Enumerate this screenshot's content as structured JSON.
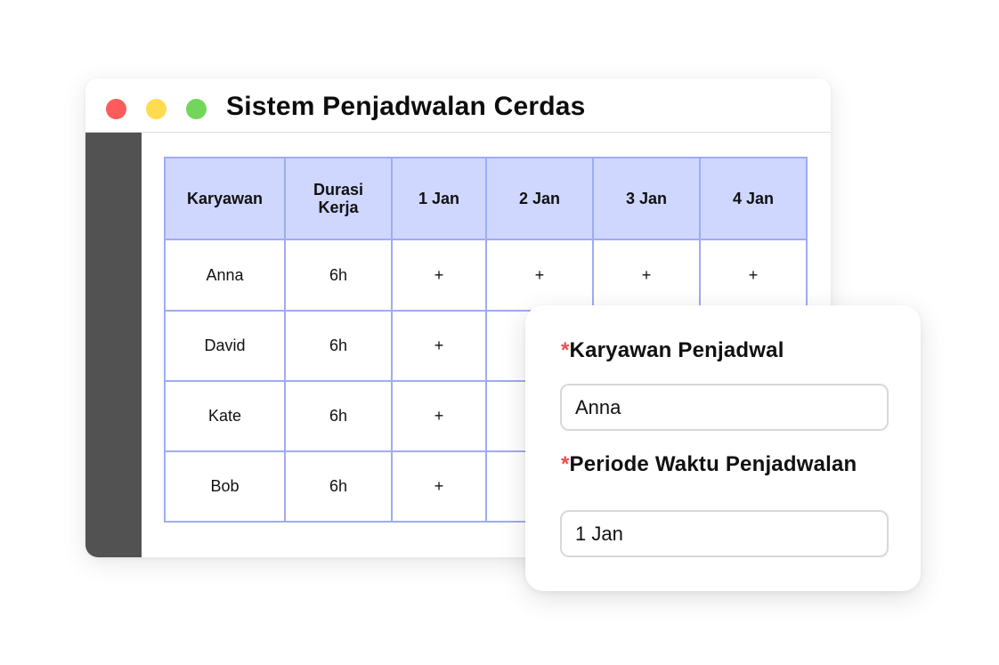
{
  "window": {
    "title": "Sistem Penjadwalan Cerdas",
    "controls": [
      "close",
      "minimize",
      "maximize"
    ]
  },
  "table": {
    "headers": {
      "employee": "Karyawan",
      "duration_line1": "Durasi",
      "duration_line2": "Kerja",
      "day1": "1 Jan",
      "day2": "2 Jan",
      "day3": "3 Jan",
      "day4": "4 Jan"
    },
    "rows": [
      {
        "name": "Anna",
        "duration": "6h",
        "cells": [
          "+",
          "+",
          "+",
          "+"
        ]
      },
      {
        "name": "David",
        "duration": "6h",
        "cells": [
          "+",
          "",
          "",
          ""
        ]
      },
      {
        "name": "Kate",
        "duration": "6h",
        "cells": [
          "+",
          "",
          "",
          ""
        ]
      },
      {
        "name": "Bob",
        "duration": "6h",
        "cells": [
          "+",
          "",
          "",
          ""
        ]
      }
    ]
  },
  "form": {
    "required_mark": "*",
    "employee_label": "Karyawan Penjadwal",
    "employee_value": "Anna",
    "period_label": "Periode Waktu Penjadwalan",
    "period_value": "1 Jan"
  },
  "colors": {
    "header_bg": "#cfd7ff",
    "grid_border": "#9fabf2",
    "sidebar": "#525252",
    "required": "#f04d4d",
    "close_dot": "#fd5c5c",
    "minimize_dot": "#ffdb4f",
    "maximize_dot": "#73d65a"
  }
}
